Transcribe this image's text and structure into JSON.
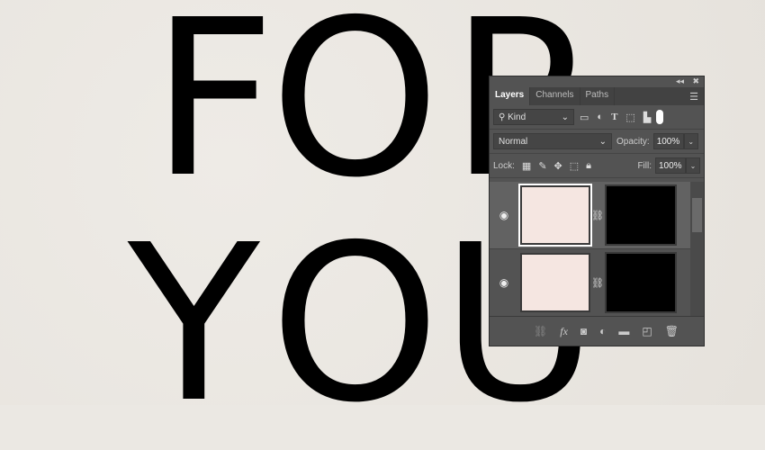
{
  "canvas": {
    "line1": [
      "F",
      "O",
      "R"
    ],
    "line2": [
      "Y",
      "O",
      "U"
    ]
  },
  "panel": {
    "tabs": [
      "Layers",
      "Channels",
      "Paths"
    ],
    "filter": {
      "kind": "Kind"
    },
    "blend": {
      "mode": "Normal",
      "opacity_label": "Opacity:",
      "opacity": "100%"
    },
    "lock": {
      "label": "Lock:",
      "fill_label": "Fill:",
      "fill": "100%"
    },
    "layers": [
      {
        "visible": true,
        "selected": true
      },
      {
        "visible": true,
        "selected": false
      }
    ]
  }
}
